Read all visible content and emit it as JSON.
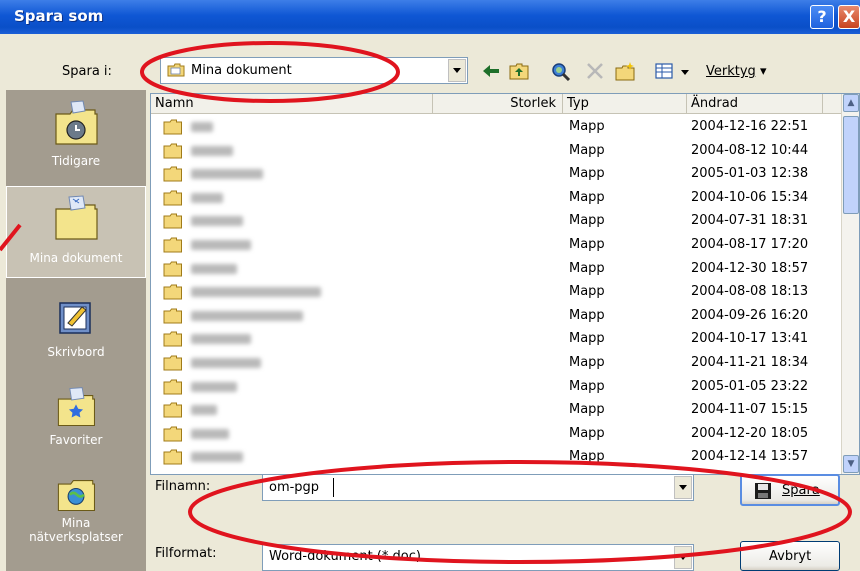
{
  "window": {
    "title": "Spara som",
    "help_label": "?",
    "close_label": "X"
  },
  "toolbar": {
    "look_in_label": "Spara i:",
    "look_in_value": "Mina dokument",
    "tools_label": "Verktyg",
    "icons": [
      "back-arrow-icon",
      "up-folder-icon",
      "search-web-icon",
      "delete-icon",
      "new-folder-icon",
      "views-icon",
      "tools-dropdown-icon"
    ]
  },
  "places": [
    {
      "label": "Tidigare",
      "icon": "history-icon"
    },
    {
      "label": "Mina dokument",
      "icon": "my-documents-icon",
      "active": true
    },
    {
      "label": "Skrivbord",
      "icon": "desktop-icon"
    },
    {
      "label": "Favoriter",
      "icon": "favorites-icon"
    },
    {
      "label_line1": "Mina",
      "label_line2": "nätverksplatser",
      "icon": "network-places-icon"
    }
  ],
  "columns": {
    "name": "Namn",
    "size": "Storlek",
    "type": "Typ",
    "modified": "Ändrad"
  },
  "files": [
    {
      "type": "Mapp",
      "modified": "2004-12-16 22:51"
    },
    {
      "type": "Mapp",
      "modified": "2004-08-12 10:44"
    },
    {
      "type": "Mapp",
      "modified": "2005-01-03 12:38"
    },
    {
      "type": "Mapp",
      "modified": "2004-10-06 15:34"
    },
    {
      "type": "Mapp",
      "modified": "2004-07-31 18:31"
    },
    {
      "type": "Mapp",
      "modified": "2004-08-17 17:20"
    },
    {
      "type": "Mapp",
      "modified": "2004-12-30 18:57"
    },
    {
      "type": "Mapp",
      "modified": "2004-08-08 18:13"
    },
    {
      "type": "Mapp",
      "modified": "2004-09-26 16:20"
    },
    {
      "type": "Mapp",
      "modified": "2004-10-17 13:41"
    },
    {
      "type": "Mapp",
      "modified": "2004-11-21 18:34"
    },
    {
      "type": "Mapp",
      "modified": "2005-01-05 23:22"
    },
    {
      "type": "Mapp",
      "modified": "2004-11-07 15:15"
    },
    {
      "type": "Mapp",
      "modified": "2004-12-20 18:05"
    },
    {
      "type": "Mapp",
      "modified": "2004-12-14 13:57"
    }
  ],
  "filename": {
    "label": "Filnamn:",
    "value": "om-pgp"
  },
  "format": {
    "label": "Filformat:",
    "value": "Word-dokument (*.doc)"
  },
  "buttons": {
    "save": "Spara",
    "cancel": "Avbryt"
  },
  "colors": {
    "annotation_red": "#e0141e",
    "title_blue": "#0a4fc8"
  }
}
